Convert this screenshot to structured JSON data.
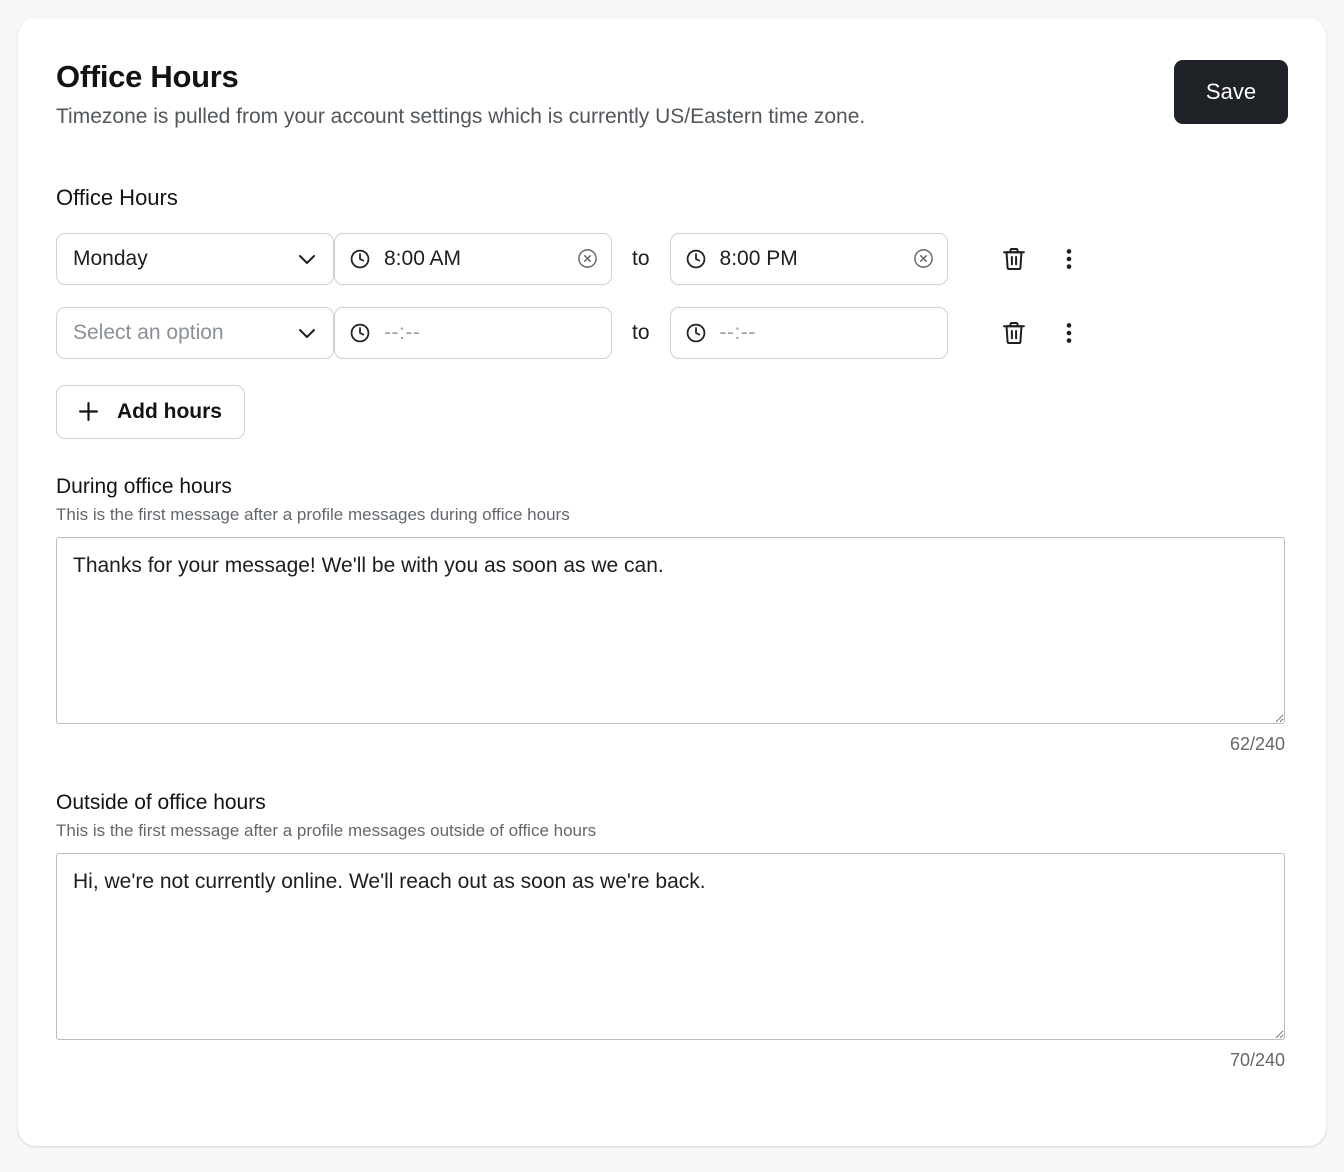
{
  "header": {
    "title": "Office Hours",
    "subtitle": "Timezone is pulled from your account settings which is currently US/Eastern time zone.",
    "save_label": "Save"
  },
  "office_hours_section": {
    "label": "Office Hours",
    "to_label": "to",
    "add_hours_label": "Add hours",
    "rows": [
      {
        "day": "Monday",
        "day_is_placeholder": false,
        "start_time": "8:00 AM",
        "start_is_placeholder": false,
        "end_time": "8:00 PM",
        "end_is_placeholder": false,
        "has_clear": true
      },
      {
        "day": "Select an option",
        "day_is_placeholder": true,
        "start_time": "--:--",
        "start_is_placeholder": true,
        "end_time": "--:--",
        "end_is_placeholder": true,
        "has_clear": false
      }
    ]
  },
  "during_office_hours": {
    "title": "During office hours",
    "help": "This is the first message after a profile messages during office hours",
    "message": "Thanks for your message! We'll be with you as soon as we can.",
    "char_count": "62/240"
  },
  "outside_office_hours": {
    "title": "Outside of office hours",
    "help": "This is the first message after a profile messages outside of office hours",
    "message": "Hi, we're not currently online. We'll reach out as soon as we're back.",
    "char_count": "70/240"
  },
  "icons": {
    "clock": "clock-icon",
    "clear": "clear-circle-icon",
    "chevron": "chevron-down-icon",
    "trash": "trash-icon",
    "kebab": "more-vertical-icon",
    "plus": "plus-icon"
  },
  "colors": {
    "accent": "#1f2227",
    "page_background": "#f7f8f9",
    "card_background": "#ffffff",
    "border": "#cdd1d5"
  }
}
